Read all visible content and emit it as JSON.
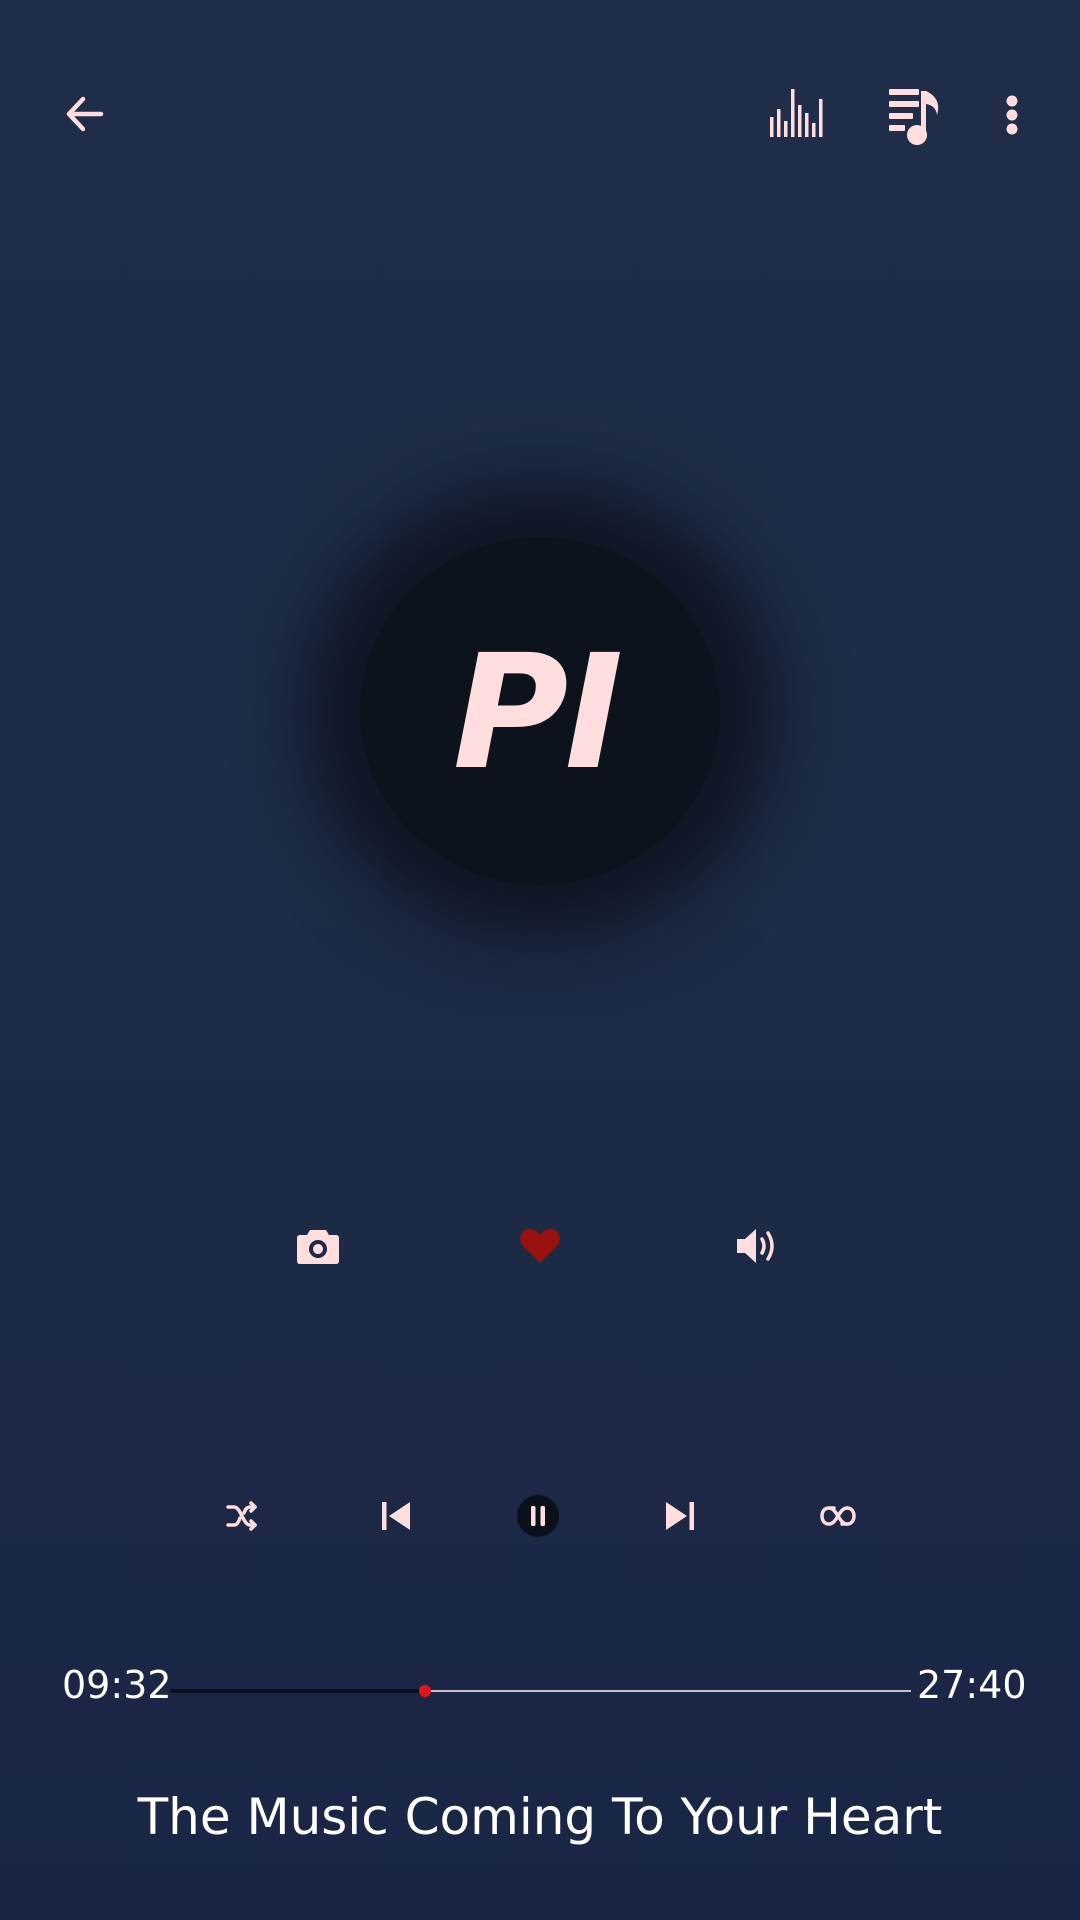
{
  "header": {
    "back_icon": "arrow-left-icon",
    "equalizer_icon": "equalizer-bars-icon",
    "queue_icon": "playlist-music-icon",
    "more_icon": "more-vertical-icon"
  },
  "album_art": {
    "initials": "PI"
  },
  "actions": {
    "camera_icon": "camera-icon",
    "favorite_icon": "heart-icon",
    "favorite_active": true,
    "volume_icon": "volume-up-icon"
  },
  "controls": {
    "shuffle_icon": "shuffle-icon",
    "previous_icon": "skip-previous-icon",
    "play_pause_icon": "pause-icon",
    "next_icon": "skip-next-icon",
    "repeat_icon": "repeat-icon"
  },
  "playback": {
    "elapsed": "09:32",
    "total": "27:40",
    "progress": 0.3446
  },
  "track": {
    "title": "The Music Coming To Your Heart"
  },
  "colors": {
    "background": "#1e2c47",
    "icon": "#ffdedd",
    "favorite": "#9a1210",
    "progress_thumb": "#e0161a",
    "progress_track": "#c7c0c6",
    "progress_fill": "#0b111b",
    "art_circle": "#0c131d"
  }
}
